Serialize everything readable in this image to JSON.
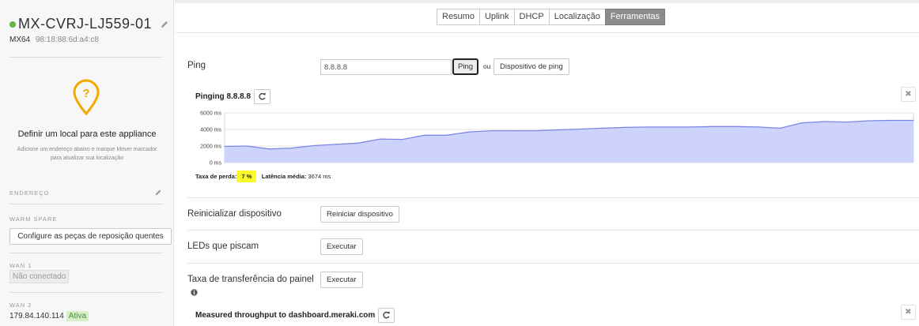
{
  "sidebar": {
    "device_name": "MX-CVRJ-LJ559-01",
    "model": "MX64",
    "mac": "98:18:88:6d:a4:c8",
    "location_title": "Definir um local para este appliance",
    "location_desc": "Adicione um endereço abaixo e marque Mover marcador para atualizar sua localização",
    "address_label": "ENDEREÇO",
    "warm_spare_label": "WARM SPARE",
    "warm_spare_button": "Configure as peças de reposição quentes",
    "wan1_label": "WAN 1",
    "wan1_status": "Não conectado",
    "wan2_label": "WAN 2",
    "wan2_ip": "179.84.140.114",
    "wan2_status": "Ativa",
    "status_color": "#67b346"
  },
  "tabs": [
    "Resumo",
    "Uplink",
    "DHCP",
    "Localização",
    "Ferramentas"
  ],
  "active_tab": "Ferramentas",
  "tools": {
    "ping": {
      "label": "Ping",
      "input_value": "8.8.8.8",
      "button": "Ping",
      "or_text": "ou",
      "device_button": "Dispositivo de ping",
      "result_title": "Pinging 8.8.8.8",
      "loss_label": "Taxa de perda:",
      "loss_value": " 7 % ",
      "latency_label": "Latência média:",
      "latency_value": "3674 ms"
    },
    "reboot": {
      "label": "Reinicializar dispositivo",
      "button": "Reiniciar dispositivo"
    },
    "leds": {
      "label": "LEDs que piscam",
      "button": "Executar"
    },
    "throughput": {
      "label": "Taxa de transferência do painel",
      "button": "Executar",
      "result_title": "Measured throughput to dashboard.meraki.com"
    }
  },
  "chart_data": {
    "type": "area",
    "ytick_labels": [
      "6000 ms",
      "4000 ms",
      "2000 ms",
      "0 ms"
    ],
    "ylim": [
      0,
      6000
    ],
    "grid": true,
    "fill_color": "#cdd3fb",
    "line_color": "#7b86e6",
    "values": [
      1950,
      2000,
      1650,
      1750,
      2050,
      2200,
      2350,
      2850,
      2800,
      3300,
      3300,
      3700,
      3850,
      3850,
      3850,
      3950,
      4050,
      4150,
      4250,
      4300,
      4300,
      4300,
      4350,
      4350,
      4300,
      4150,
      4800,
      4950,
      4900,
      5050,
      5100,
      5100
    ]
  }
}
